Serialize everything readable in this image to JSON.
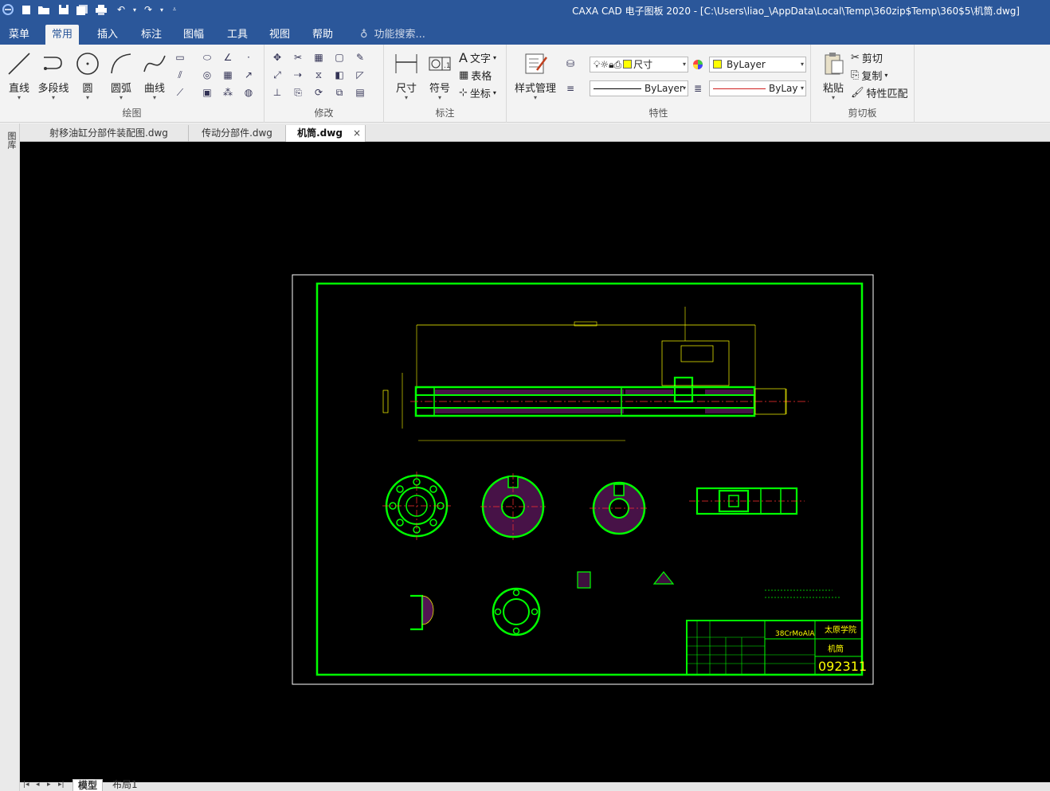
{
  "title_bar": {
    "title": "CAXA CAD 电子图板 2020 - [C:\\Users\\liao_\\AppData\\Local\\Temp\\360zip$Temp\\360$5\\机筒.dwg]"
  },
  "menu": {
    "tabs": [
      "菜单",
      "常用",
      "插入",
      "标注",
      "图幅",
      "工具",
      "视图",
      "帮助"
    ],
    "active_tab": "常用",
    "search_label": "功能搜索..."
  },
  "ribbon": {
    "draw": {
      "label": "绘图",
      "line": "直线",
      "polyline": "多段线",
      "circle": "圆",
      "arc": "圆弧",
      "curve": "曲线"
    },
    "modify": {
      "label": "修改"
    },
    "annotate": {
      "label": "标注",
      "dimension": "尺寸",
      "symbol": "符号",
      "text": "文字",
      "table": "表格",
      "coord": "坐标"
    },
    "properties": {
      "label": "特性",
      "style_manager": "样式管理",
      "layer_combo": "尺寸",
      "color_combo": "ByLayer",
      "linetype_combo": "ByLayer",
      "lineweight_combo": "ByLay"
    },
    "clipboard": {
      "label": "剪切板",
      "paste": "粘贴",
      "cut": "剪切",
      "copy": "复制",
      "match": "特性匹配"
    }
  },
  "doc_tabs": [
    {
      "label": "射移油缸分部件装配图.dwg",
      "active": false
    },
    {
      "label": "传动分部件.dwg",
      "active": false
    },
    {
      "label": "机筒.dwg",
      "active": true
    }
  ],
  "left_panel": {
    "label": "图库"
  },
  "drawing": {
    "title_block": {
      "school": "太原学院",
      "part_name": "机筒",
      "material": "38CrMoAlA",
      "drawing_no": "092311"
    }
  },
  "layout_tabs": {
    "tabs": [
      "模型",
      "布局1"
    ],
    "active": "模型"
  },
  "colors": {
    "title_bar": "#2b579a",
    "canvas": "#000000",
    "drawing_green": "#00ff00",
    "drawing_yellow": "#ffff00",
    "hatch_magenta": "#cc33cc",
    "center_red": "#ff3030"
  }
}
